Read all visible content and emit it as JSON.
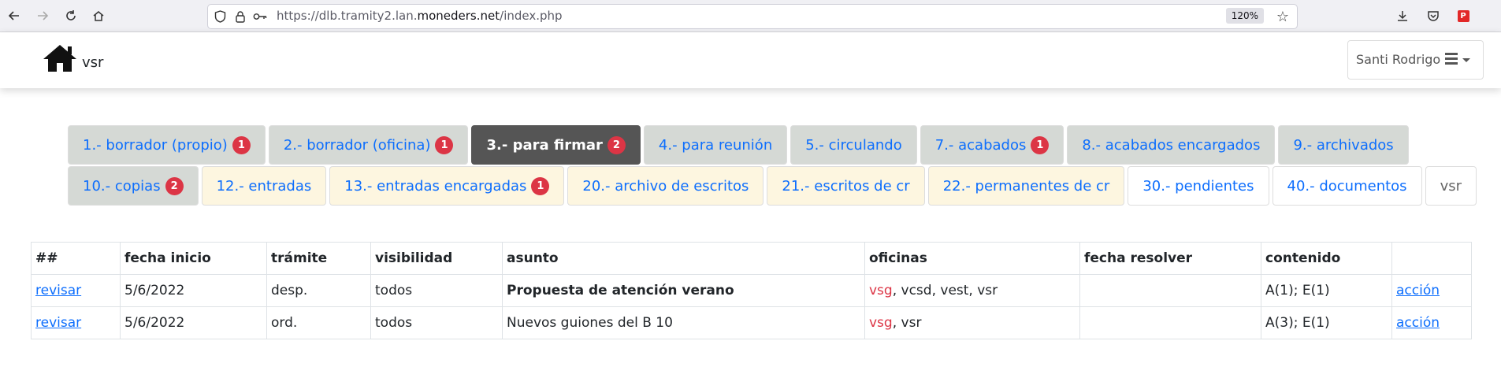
{
  "browser": {
    "url_prefix": "https://dlb.tramity2.lan.",
    "url_domain": "moneders.net",
    "url_path": "/index.php",
    "zoom": "120%"
  },
  "header": {
    "brand": "vsr",
    "user_name": "Santi Rodrigo"
  },
  "tabs_row1": [
    {
      "label": "1.- borrador (propio)",
      "badge": "1"
    },
    {
      "label": "2.- borrador (oficina)",
      "badge": "1"
    },
    {
      "label": "3.- para firmar",
      "badge": "2"
    },
    {
      "label": "4.- para reunión"
    },
    {
      "label": "5.- circulando"
    },
    {
      "label": "7.- acabados",
      "badge": "1"
    },
    {
      "label": "8.- acabados encargados"
    },
    {
      "label": "9.- archivados"
    }
  ],
  "tabs_row2": [
    {
      "label": "10.- copias",
      "badge": "2"
    },
    {
      "label": "12.- entradas"
    },
    {
      "label": "13.- entradas encargadas",
      "badge": "1"
    },
    {
      "label": "20.- archivo de escritos"
    },
    {
      "label": "21.- escritos de cr"
    },
    {
      "label": "22.- permanentes de cr"
    },
    {
      "label": "30.- pendientes"
    },
    {
      "label": "40.- documentos"
    },
    {
      "label": "vsr"
    }
  ],
  "table": {
    "headers": [
      "##",
      "fecha inicio",
      "trámite",
      "visibilidad",
      "asunto",
      "oficinas",
      "fecha resolver",
      "contenido",
      ""
    ],
    "rows": [
      {
        "link": "revisar",
        "fecha": "5/6/2022",
        "tramite": "desp.",
        "visibilidad": "todos",
        "asunto": "Propuesta de atención verano",
        "oficina_main": "vsg",
        "oficinas_rest": ", vcsd, vest, vsr",
        "fecha_resolver": "",
        "contenido": "A(1); E(1)",
        "accion": "acción"
      },
      {
        "link": "revisar",
        "fecha": "5/6/2022",
        "tramite": "ord.",
        "visibilidad": "todos",
        "asunto": "Nuevos guiones del B 10",
        "oficina_main": "vsg",
        "oficinas_rest": ", vsr",
        "fecha_resolver": "",
        "contenido": "A(3); E(1)",
        "accion": "acción"
      }
    ]
  },
  "colors": {
    "link": "#0d6efd",
    "badge": "#dc3545",
    "active_tab": "#555555",
    "grey_tab": "#d5d9d5",
    "cream_tab": "#fdf6e0"
  }
}
